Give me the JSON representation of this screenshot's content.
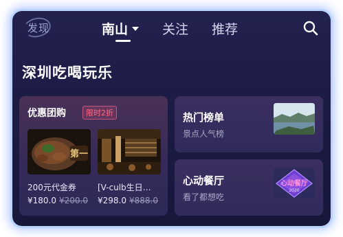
{
  "header": {
    "logo": "发现",
    "tabs": [
      {
        "label": "南山",
        "active": true
      },
      {
        "label": "关注",
        "active": false
      },
      {
        "label": "推荐",
        "active": false
      }
    ]
  },
  "section": {
    "title": "深圳吃喝玩乐"
  },
  "group_buy": {
    "title": "优惠团购",
    "badge": "限时2折",
    "deals": [
      {
        "name": "200元代金券",
        "price": "¥180.0",
        "original_price": "¥200.0"
      },
      {
        "name": "[V-culb生日…",
        "price": "¥298.0",
        "original_price": "¥888.0"
      }
    ]
  },
  "hot_list": {
    "title": "热门榜单",
    "subtitle": "景点人气榜"
  },
  "heart_restaurant": {
    "title": "心动餐厅",
    "subtitle": "看了都想吃",
    "logo_text": "心动餐厅",
    "logo_year": "2020"
  },
  "colors": {
    "background": "#1c1b44",
    "badge": "#ff6b8a",
    "glow": "#b9d3ff"
  }
}
